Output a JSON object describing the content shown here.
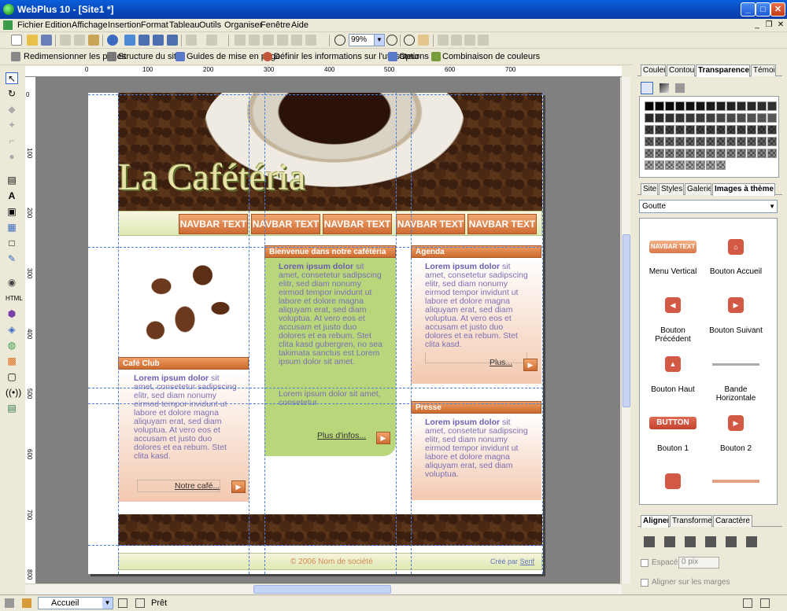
{
  "window": {
    "title": "WebPlus 10 - [Site1 *]",
    "min": "_",
    "max": "□",
    "close": "✕"
  },
  "menu": [
    "Fichier",
    "Edition",
    "Affichage",
    "Insertion",
    "Format",
    "Tableau",
    "Outils",
    "Organiser",
    "Fenêtre",
    "Aide"
  ],
  "toolbar": {
    "zoom": "99%"
  },
  "toolbar2": {
    "resize_pages": "Redimensionner les pages",
    "site_structure": "Structure du site",
    "layout_guides": "Guides de mise en page",
    "user_info": "Définir les informations sur l'utilisateur",
    "options": "Options",
    "color_scheme": "Combinaison de couleurs"
  },
  "ruler": {
    "top": [
      "0",
      "100",
      "200",
      "300",
      "400",
      "500",
      "600",
      "700"
    ],
    "left": [
      "0",
      "100",
      "200",
      "300",
      "400",
      "500",
      "600",
      "700",
      "800"
    ]
  },
  "page": {
    "logo": "La Cafétéria",
    "navbar": [
      "NAVBAR TEXT",
      "NAVBAR TEXT",
      "NAVBAR TEXT",
      "NAVBAR TEXT",
      "NAVBAR TEXT"
    ],
    "col1": {
      "heading": "Café Club",
      "lorem_bold": "Lorem ipsum dolor",
      "lorem": " sit amet, consetetur sadipscing elitr, sed diam nonumy eirmod tempor invidunt ut labore et dolore magna aliquyam erat, sed diam voluptua. At vero eos et accusam et justo duo dolores et ea rebum. Stet clita kasd.",
      "more": "Notre café..."
    },
    "col2": {
      "heading": "Bienvenue dans notre cafétéria",
      "lorem_bold": "Lorem ipsum dolor",
      "lorem": " sit amet, consetetur sadipscing elitr, sed diam nonumy eirmod tempor invidunt ut labore et dolore magna aliquyam erat, sed diam voluptua. At vero eos et accusam et justo duo dolores et ea rebum. Stet clita kasd gubergren, no sea takimata sanctus est Lorem ipsum dolor sit amet.",
      "lorem2": "Lorem ipsum dolor sit amet, consetetur",
      "more": "Plus d'infos..."
    },
    "col3a": {
      "heading": "Agenda",
      "lorem_bold": "Lorem ipsum dolor",
      "lorem": " sit amet, consetetur sadipscing elitr, sed diam nonumy eirmod tempor invidunt ut labore et dolore magna aliquyam erat, sed diam voluptua. At vero eos et accusam et justo duo dolores et ea rebum. Stet clita kasd.",
      "more": "Plus..."
    },
    "col3b": {
      "heading": "Presse",
      "lorem_bold": "Lorem ipsum dolor",
      "lorem": " sit amet, consetetur sadipscing elitr, sed diam nonumy eirmod tempor invidunt ut labore et dolore magna aliquyam erat, sed diam voluptua."
    },
    "footer": {
      "copyright": "© 2006 Nom de société",
      "credit": "Créé par ",
      "credit_link": "Serif"
    }
  },
  "panel1": {
    "tabs": [
      "Couleur",
      "Contour",
      "Transparence",
      "Témoin"
    ],
    "active": 2
  },
  "panel2": {
    "tabs": [
      "Site",
      "Styles",
      "Galerie",
      "Images à thème"
    ],
    "active": 3,
    "dropdown": "Goutte",
    "items": [
      {
        "label": "Menu Vertical",
        "sample": "NAVBAR TEXT"
      },
      {
        "label": "Bouton Accueil"
      },
      {
        "label": "Bouton Précédent"
      },
      {
        "label": "Bouton Suivant"
      },
      {
        "label": "Bouton Haut"
      },
      {
        "label": "Bande Horizontale"
      },
      {
        "label": "Bouton 1",
        "sample": "BUTTON"
      },
      {
        "label": "Bouton 2"
      }
    ]
  },
  "panel3": {
    "tabs": [
      "Aligner",
      "Transformer",
      "Caractère"
    ],
    "active": 0,
    "spacing_label": "Espacé",
    "spacing_value": "0 pix",
    "margins_label": "Aligner sur les marges"
  },
  "status": {
    "page": "Accueil",
    "text": "Prêt"
  }
}
